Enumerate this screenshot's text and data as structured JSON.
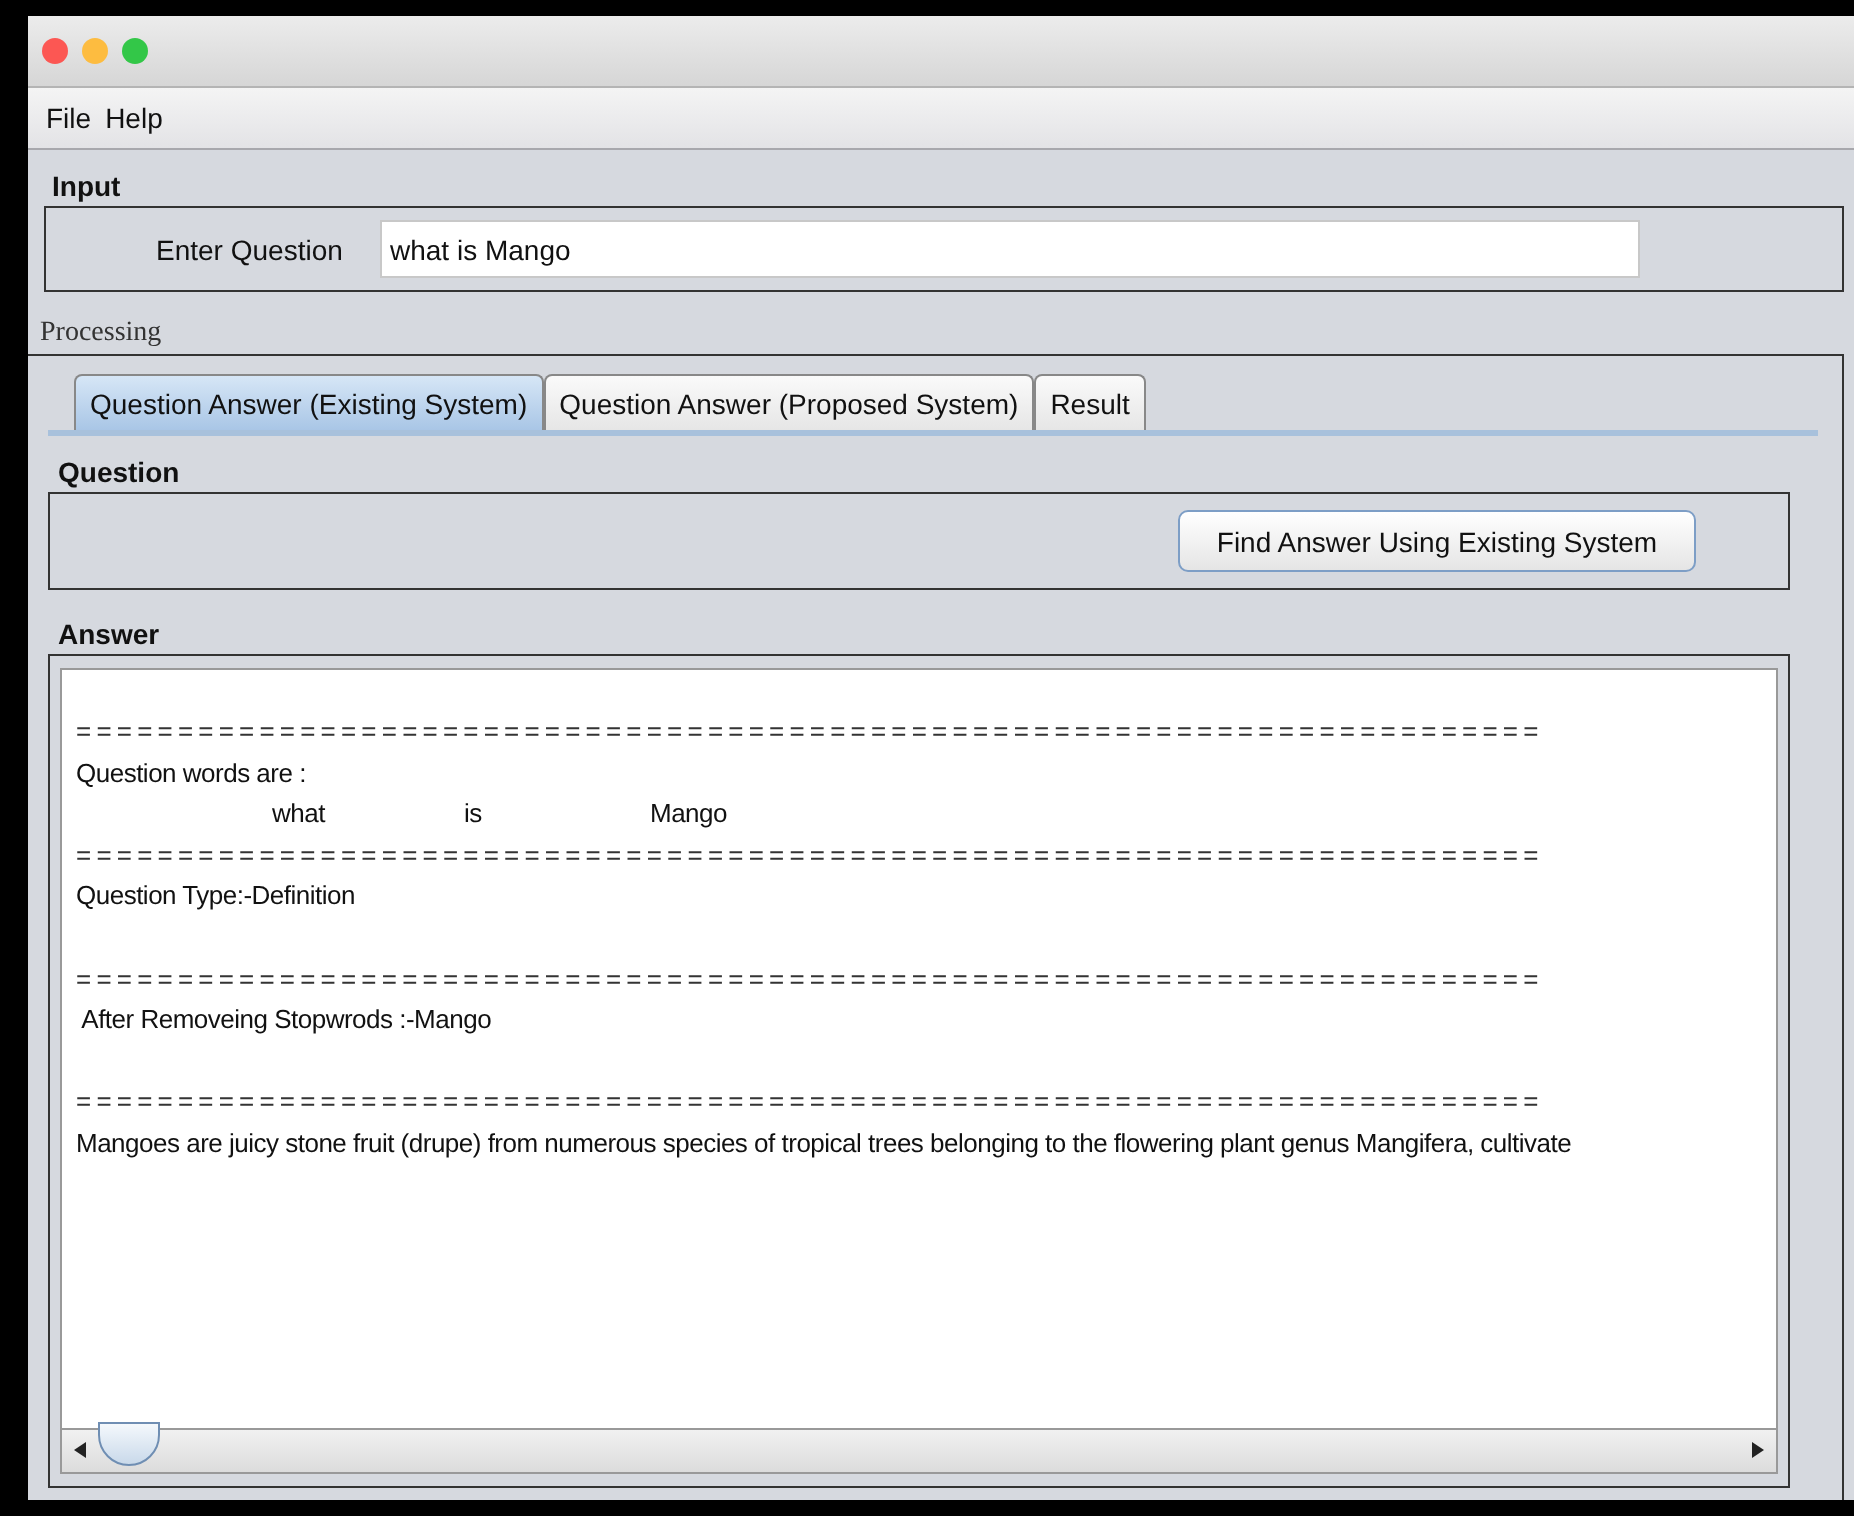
{
  "menu": [
    {
      "label": "File"
    },
    {
      "label": "Help"
    }
  ],
  "input": {
    "title": "Input",
    "label": "Enter Question",
    "value": "what is Mango"
  },
  "processing": {
    "title": "Processing",
    "tabs": [
      {
        "label": "Question Answer (Existing System)",
        "selected": true
      },
      {
        "label": "Question Answer (Proposed System)",
        "selected": false
      },
      {
        "label": "Result",
        "selected": false
      }
    ],
    "question": {
      "title": "Question",
      "button": "Find Answer Using Existing System"
    },
    "answer": {
      "title": "Answer",
      "lines": [
        {
          "kind": "separator",
          "text": "========================================================================"
        },
        {
          "kind": "text",
          "text": "Question words are :"
        },
        {
          "kind": "words",
          "words": [
            "what",
            "is",
            "Mango"
          ]
        },
        {
          "kind": "separator",
          "text": "========================================================================"
        },
        {
          "kind": "text",
          "text": "Question Type:-Definition",
          "blank_after": true
        },
        {
          "kind": "separator",
          "text": "========================================================================"
        },
        {
          "kind": "text",
          "text": " After Removeing Stopwrods :-Mango",
          "blank_after": true
        },
        {
          "kind": "separator",
          "text": "========================================================================"
        },
        {
          "kind": "text",
          "text": "Mangoes are juicy stone fruit (drupe) from numerous species of tropical trees belonging to the flowering plant genus Mangifera, cultivate"
        }
      ]
    }
  }
}
